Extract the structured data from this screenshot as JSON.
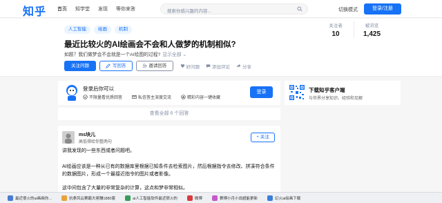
{
  "header": {
    "logo": "知乎",
    "nav": [
      "首页",
      "知学堂",
      "发现",
      "等你来答"
    ],
    "search_placeholder": "搜索你感兴趣的内容...",
    "toggle_mode": "切换模式",
    "login_register": "登录/注册"
  },
  "question": {
    "tags": [
      "人工智能",
      "绘画",
      "机制"
    ],
    "title": "最近比较火的AI绘画会不会和人做梦的机制相似?",
    "description": "如题？我们做梦会不会就是一个AI绘图的过程?",
    "show_all": "显示全部",
    "follower_label": "关注者",
    "follower_count": "10",
    "viewed_label": "被浏览",
    "viewed_count": "1,425",
    "actions": {
      "follow": "关注问题",
      "write": "写回答",
      "invite": "邀请回答",
      "good": "好问题",
      "comment": "添加评论",
      "share": "分享"
    }
  },
  "login_prompt": {
    "title": "登录后你可以",
    "features": [
      "不限量看优质回答",
      "私信答主深度交流",
      "精彩内容一键收藏"
    ],
    "button": "登录"
  },
  "view_all": "查看全部 6 个回答",
  "answer": {
    "author": "ms块儿",
    "bio": "高低得给你整两句",
    "follow": "关注",
    "paragraphs": [
      "讲我发现的一些东西或者问题吧。",
      "AI绘画应该是一种从已有的数据库里根据已知条件去检索图片，然后根据指令去修改、拼凑符合条件的数据图片，形成一个最接近指令的图片或者影像。",
      "这中间包含了大量的非常复杂的计算，这点和梦非常相似。"
    ]
  },
  "app_card": {
    "title": "下载知乎客户端",
    "subtitle": "与世界分享知识、经验和见解"
  },
  "taskbar": [
    {
      "label": "最近很火的ai画画你...",
      "color": "#4a7bd0"
    },
    {
      "label": "抗拿风云赛霸大佬赚1880套",
      "color": "#e8a23a"
    },
    {
      "label": "ai人工智能软件最近很火的",
      "color": "#3a9c5a"
    },
    {
      "label": "微博",
      "color": "#d93b3b"
    },
    {
      "label": "赛博小月小说超能更新",
      "color": "#c45ac7"
    },
    {
      "label": "幻火ai绘画下载",
      "color": "#3a7fd9"
    }
  ]
}
